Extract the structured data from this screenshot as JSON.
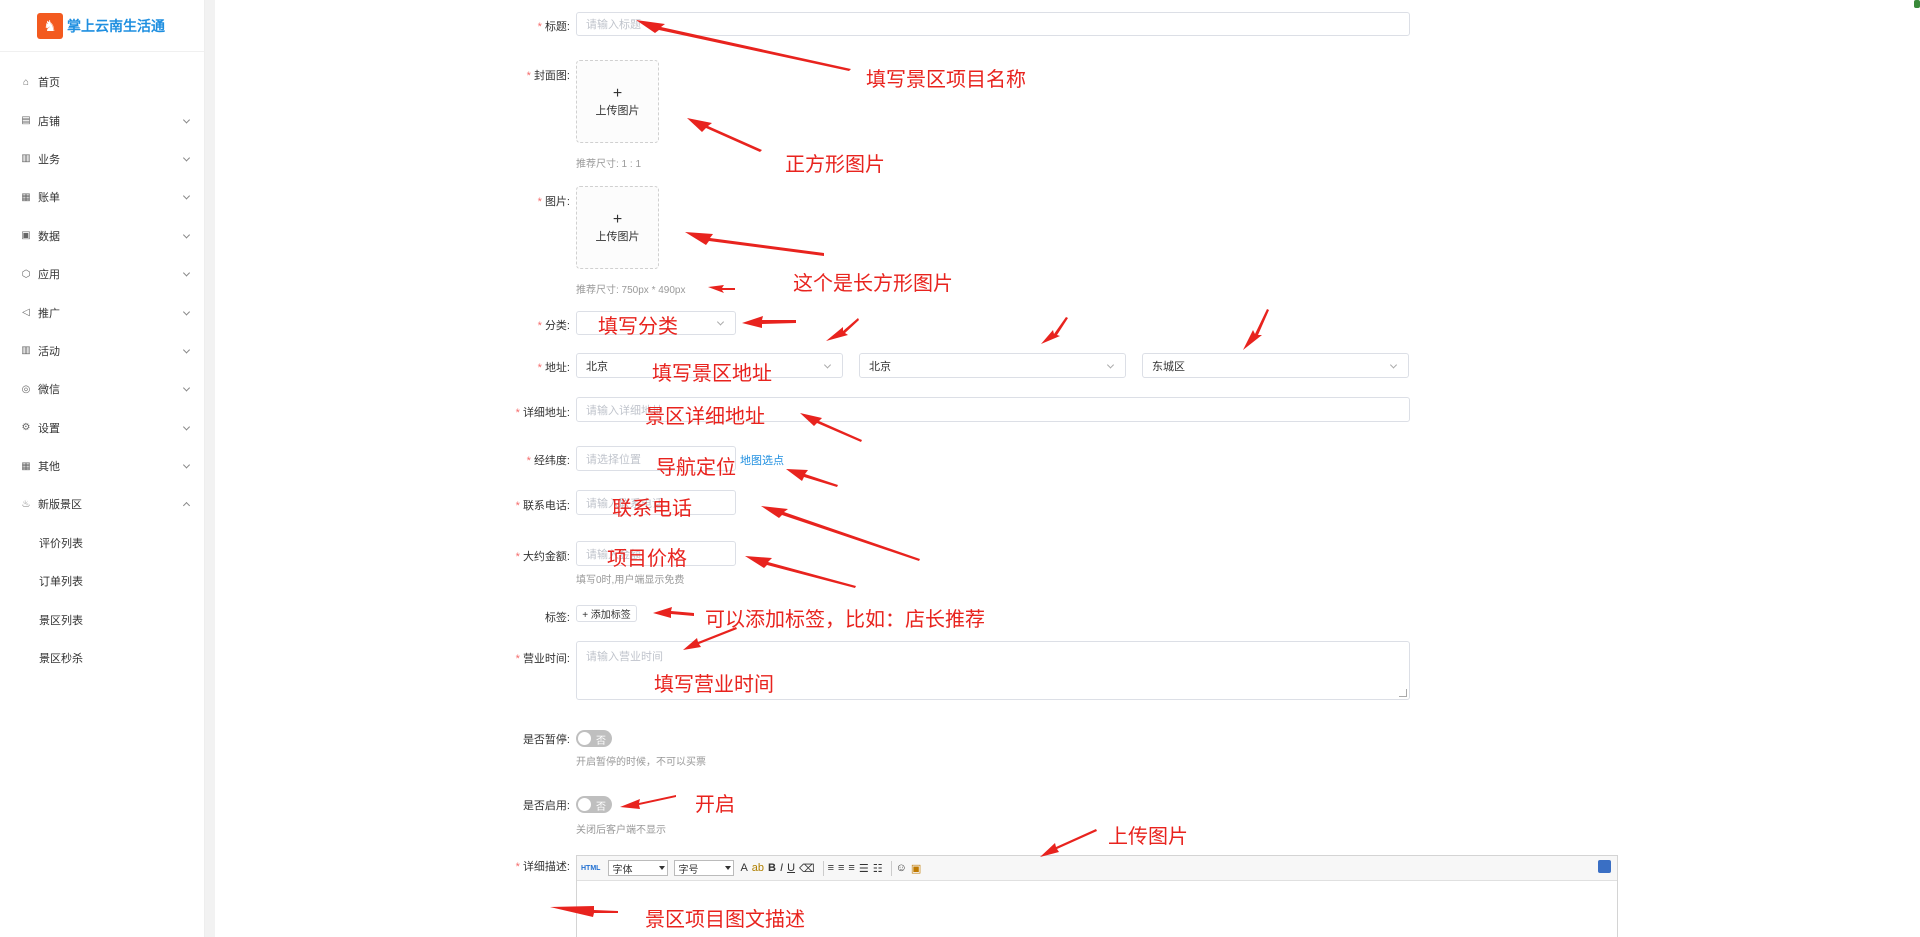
{
  "sidebar": {
    "logo_text": "掌上云南生活通",
    "items": [
      {
        "label": "首页",
        "icon": "⌂"
      },
      {
        "label": "店铺",
        "icon": "▤"
      },
      {
        "label": "业务",
        "icon": "▥"
      },
      {
        "label": "账单",
        "icon": "▦"
      },
      {
        "label": "数据",
        "icon": "▣"
      },
      {
        "label": "应用",
        "icon": "⬡"
      },
      {
        "label": "推广",
        "icon": "◁"
      },
      {
        "label": "活动",
        "icon": "▥"
      },
      {
        "label": "微信",
        "icon": "◎"
      },
      {
        "label": "设置",
        "icon": "⚙"
      },
      {
        "label": "其他",
        "icon": "▦"
      },
      {
        "label": "新版景区",
        "icon": "♨"
      }
    ],
    "sub_items": [
      {
        "label": "评价列表"
      },
      {
        "label": "订单列表"
      },
      {
        "label": "景区列表"
      },
      {
        "label": "景区秒杀"
      }
    ]
  },
  "form": {
    "title": {
      "label": "标题:",
      "placeholder": "请输入标题"
    },
    "cover": {
      "label": "封面图:",
      "upload_text": "上传图片",
      "hint": "推荐尺寸: 1 : 1"
    },
    "images": {
      "label": "图片:",
      "upload_text": "上传图片",
      "hint": "推荐尺寸: 750px * 490px"
    },
    "category": {
      "label": "分类:"
    },
    "address": {
      "label": "地址:",
      "province": "北京",
      "city": "北京",
      "district": "东城区"
    },
    "detail_address": {
      "label": "详细地址:",
      "placeholder": "请输入详细地址"
    },
    "latlng": {
      "label": "经纬度:",
      "placeholder": "请选择位置",
      "map_link": "地图选点"
    },
    "phone": {
      "label": "联系电话:",
      "placeholder": "请输入联系电话"
    },
    "price": {
      "label": "大约金额:",
      "placeholder": "请输入金额",
      "hint": "填写0时,用户端显示免费"
    },
    "tags": {
      "label": "标签:",
      "add_button": "+ 添加标签"
    },
    "hours": {
      "label": "营业时间:",
      "placeholder": "请输入营业时间"
    },
    "paused": {
      "label": "是否暂停:",
      "switch_text": "否",
      "hint": "开启暂停的时候，不可以买票"
    },
    "enabled": {
      "label": "是否启用:",
      "switch_text": "否",
      "hint": "关闭后客户端不显示"
    },
    "description": {
      "label": "详细描述:",
      "toolbar": {
        "html": "HTML",
        "font_family": "字体",
        "font_size": "字号",
        "font_color": "A",
        "highlight": "ab",
        "bold": "B",
        "italic": "I",
        "underline": "U"
      }
    }
  },
  "annotations": {
    "title": "填写景区项目名称",
    "cover": "正方形图片",
    "images": "这个是长方形图片",
    "category": "填写分类",
    "address": "填写景区地址",
    "detail_address": "景区详细地址",
    "latlng": "导航定位",
    "phone": "联系电话",
    "price": "项目价格",
    "tags": "可以添加标签，比如：店长推荐",
    "hours": "填写营业时间",
    "enabled": "开启",
    "upload": "上传图片",
    "description": "景区项目图文描述"
  },
  "colors": {
    "required": "#f56c6c",
    "annotation": "#e8231e",
    "link": "#1f8fe0",
    "logo": "#f35a1f"
  }
}
